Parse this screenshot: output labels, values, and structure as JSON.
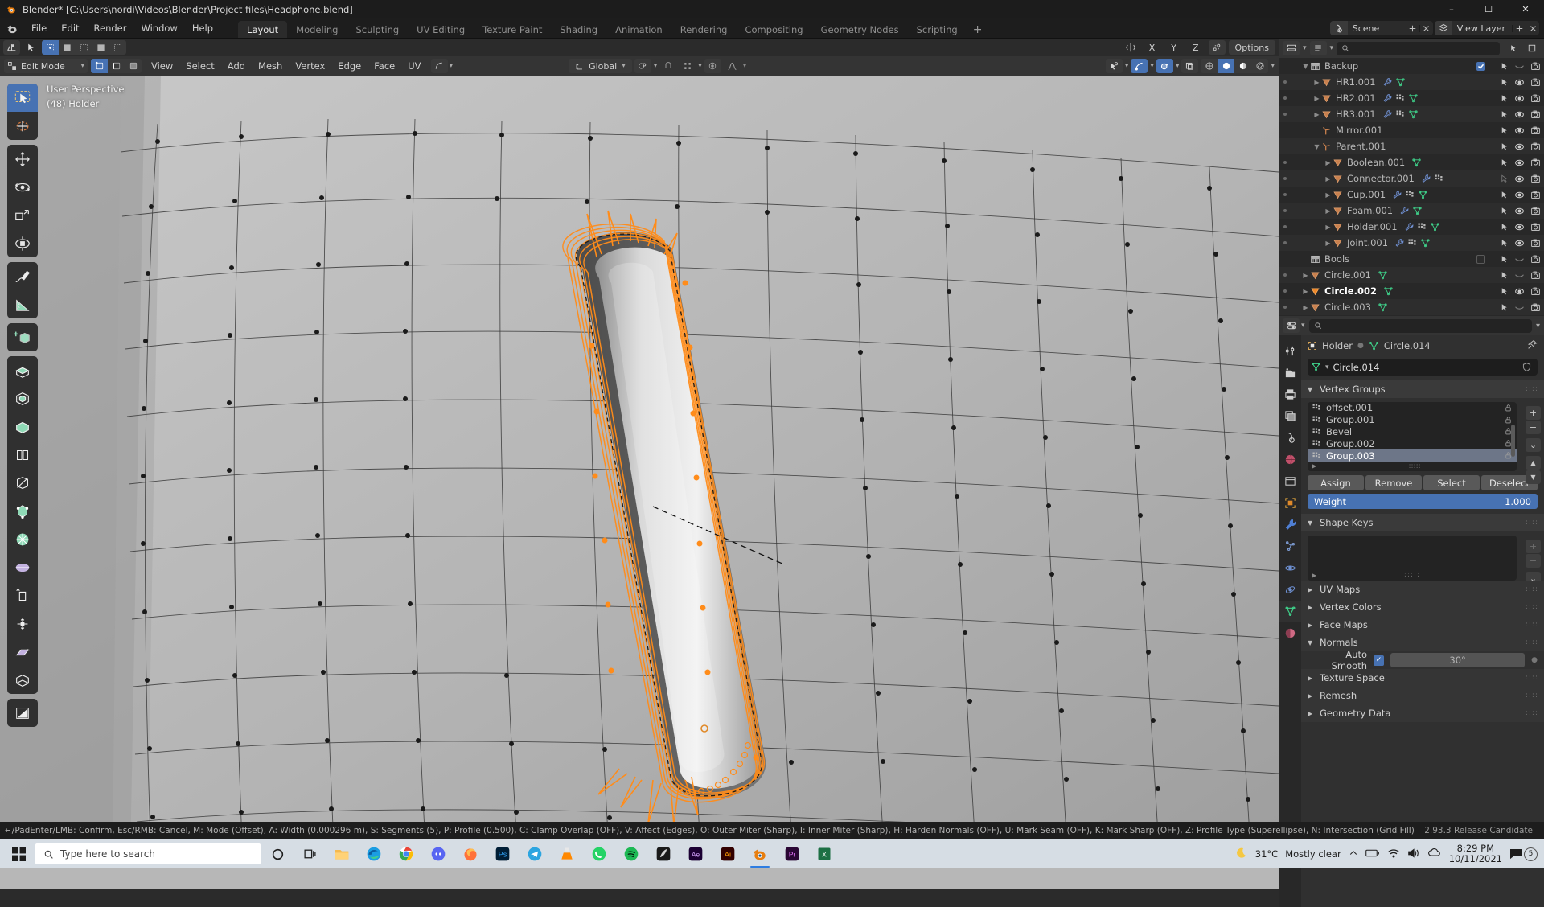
{
  "window": {
    "title": "Blender* [C:\\Users\\nordi\\Videos\\Blender\\Project files\\Headphone.blend]",
    "minimize": "–",
    "maximize": "☐",
    "close": "✕"
  },
  "topbar": {
    "menus": [
      "File",
      "Edit",
      "Render",
      "Window",
      "Help"
    ],
    "workspaces": [
      {
        "label": "Layout",
        "active": true
      },
      {
        "label": "Modeling",
        "active": false
      },
      {
        "label": "Sculpting",
        "active": false
      },
      {
        "label": "UV Editing",
        "active": false
      },
      {
        "label": "Texture Paint",
        "active": false
      },
      {
        "label": "Shading",
        "active": false
      },
      {
        "label": "Animation",
        "active": false
      },
      {
        "label": "Rendering",
        "active": false
      },
      {
        "label": "Compositing",
        "active": false
      },
      {
        "label": "Geometry Nodes",
        "active": false
      },
      {
        "label": "Scripting",
        "active": false
      }
    ],
    "add_workspace": "+",
    "scene_name": "Scene",
    "view_layer_name": "View Layer"
  },
  "viewport": {
    "header": {
      "transform_orientation": "Global",
      "options": "Options",
      "axis_x": "X",
      "axis_y": "Y",
      "axis_z": "Z"
    },
    "header2": {
      "mode": "Edit Mode",
      "menus": [
        "View",
        "Select",
        "Add",
        "Mesh",
        "Vertex",
        "Edge",
        "Face",
        "UV"
      ]
    },
    "overlay_line1": "User Perspective",
    "overlay_line2": "(48) Holder"
  },
  "outliner": {
    "rows": [
      {
        "indent": 1,
        "name": "Backup",
        "type": "collection",
        "expand": "down",
        "checkbox": true,
        "checked": true,
        "restrict": [
          "filter",
          "curve",
          "camera"
        ],
        "icons": []
      },
      {
        "indent": 2,
        "name": "HR1.001",
        "type": "mesh",
        "expand": "right",
        "dot": true,
        "icons": [
          "wrench",
          "triangles"
        ],
        "restrict": [
          "filter",
          "eye",
          "camera"
        ]
      },
      {
        "indent": 2,
        "name": "HR2.001",
        "type": "mesh",
        "expand": "right",
        "dot": true,
        "icons": [
          "wrench",
          "modifier",
          "triangles"
        ],
        "restrict": [
          "filter",
          "eye",
          "camera"
        ]
      },
      {
        "indent": 2,
        "name": "HR3.001",
        "type": "mesh",
        "expand": "right",
        "dot": true,
        "icons": [
          "wrench",
          "modifier",
          "triangles"
        ],
        "restrict": [
          "filter",
          "eye",
          "camera"
        ]
      },
      {
        "indent": 2,
        "name": "Mirror.001",
        "type": "empty",
        "expand": "none",
        "icons": [],
        "restrict": [
          "filter",
          "eye",
          "camera"
        ]
      },
      {
        "indent": 2,
        "name": "Parent.001",
        "type": "empty",
        "expand": "down",
        "icons": [],
        "restrict": [
          "filter",
          "eye",
          "camera"
        ]
      },
      {
        "indent": 3,
        "name": "Boolean.001",
        "type": "mesh",
        "expand": "right",
        "dot": true,
        "icons": [
          "triangles"
        ],
        "restrict": [
          "filter",
          "eye",
          "camera"
        ]
      },
      {
        "indent": 3,
        "name": "Connector.001",
        "type": "mesh",
        "expand": "right",
        "dot": true,
        "icons": [
          "wrench",
          "modifier"
        ],
        "restrict": [
          "filter-off",
          "eye",
          "camera"
        ]
      },
      {
        "indent": 3,
        "name": "Cup.001",
        "type": "mesh",
        "expand": "right",
        "dot": true,
        "icons": [
          "wrench",
          "modifier",
          "triangles"
        ],
        "restrict": [
          "filter",
          "eye",
          "camera"
        ]
      },
      {
        "indent": 3,
        "name": "Foam.001",
        "type": "mesh",
        "expand": "right",
        "dot": true,
        "icons": [
          "wrench",
          "triangles"
        ],
        "restrict": [
          "filter",
          "eye",
          "camera"
        ]
      },
      {
        "indent": 3,
        "name": "Holder.001",
        "type": "mesh",
        "expand": "right",
        "dot": true,
        "icons": [
          "wrench",
          "modifier",
          "triangles"
        ],
        "restrict": [
          "filter",
          "eye",
          "camera"
        ]
      },
      {
        "indent": 3,
        "name": "Joint.001",
        "type": "mesh",
        "expand": "right",
        "dot": true,
        "icons": [
          "wrench",
          "modifier",
          "triangles"
        ],
        "restrict": [
          "filter",
          "eye",
          "camera"
        ]
      },
      {
        "indent": 1,
        "name": "Bools",
        "type": "collection",
        "expand": "none",
        "checkbox": true,
        "checked": false,
        "restrict": [
          "filter",
          "curve",
          "camera"
        ],
        "icons": []
      },
      {
        "indent": 1,
        "name": "Circle.001",
        "type": "mesh",
        "expand": "right",
        "dot": true,
        "icons": [
          "triangles"
        ],
        "restrict": [
          "filter",
          "curve",
          "camera"
        ]
      },
      {
        "indent": 1,
        "name": "Circle.002",
        "type": "mesh",
        "expand": "right",
        "dot": true,
        "selected": true,
        "icons": [
          "triangles"
        ],
        "restrict": [
          "filter",
          "eye",
          "camera"
        ]
      },
      {
        "indent": 1,
        "name": "Circle.003",
        "type": "mesh",
        "expand": "right",
        "dot": true,
        "icons": [
          "triangles"
        ],
        "restrict": [
          "filter",
          "curve",
          "camera"
        ]
      }
    ]
  },
  "properties": {
    "breadcrumb_object": "Holder",
    "breadcrumb_data": "Circle.014",
    "data_name": "Circle.014",
    "vertex_groups": {
      "title": "Vertex Groups",
      "items": [
        {
          "name": "offset.001",
          "selected": false
        },
        {
          "name": "Group.001",
          "selected": false
        },
        {
          "name": "Bevel",
          "selected": false
        },
        {
          "name": "Group.002",
          "selected": false
        },
        {
          "name": "Group.003",
          "selected": true
        }
      ],
      "buttons": [
        "Assign",
        "Remove",
        "Select",
        "Deselect"
      ],
      "weight_label": "Weight",
      "weight_value": "1.000",
      "add": "+",
      "remove": "−",
      "menu": "⌄",
      "up": "▲",
      "down": "▼"
    },
    "shape_keys": {
      "title": "Shape Keys",
      "add": "+",
      "remove": "−",
      "menu": "⌄"
    },
    "sections": [
      {
        "title": "UV Maps",
        "open": false
      },
      {
        "title": "Vertex Colors",
        "open": false
      },
      {
        "title": "Face Maps",
        "open": false
      }
    ],
    "normals": {
      "title": "Normals",
      "auto_smooth_label": "Auto Smooth",
      "auto_smooth_checked": true,
      "angle": "30°"
    },
    "sections_bottom": [
      {
        "title": "Texture Space",
        "open": false
      },
      {
        "title": "Remesh",
        "open": false
      },
      {
        "title": "Geometry Data",
        "open": false
      }
    ]
  },
  "statusbar": {
    "text": "↵/PadEnter/LMB: Confirm, Esc/RMB: Cancel, M: Mode (Offset), A: Width (0.000296 m), S: Segments (5), P: Profile (0.500), C: Clamp Overlap (OFF), V: Affect (Edges), O: Outer Miter (Sharp), I: Inner Miter (Sharp), H: Harden Normals (OFF), U: Mark Seam (OFF), K: Mark Sharp (OFF), Z: Profile Type (Superellipse), N: Intersection (Grid Fill)",
    "version": "2.93.3 Release Candidate"
  },
  "taskbar": {
    "search_placeholder": "Type here to search",
    "temperature": "31°C",
    "weather": "Mostly clear",
    "time": "8:29 PM",
    "date": "10/11/2021",
    "notification_count": "5"
  },
  "colors": {
    "accent_blue": "#4772b3",
    "selected_orange": "#ff8c1a",
    "mesh_orange": "#c87d4b",
    "mesh_green": "#3fd18a"
  }
}
